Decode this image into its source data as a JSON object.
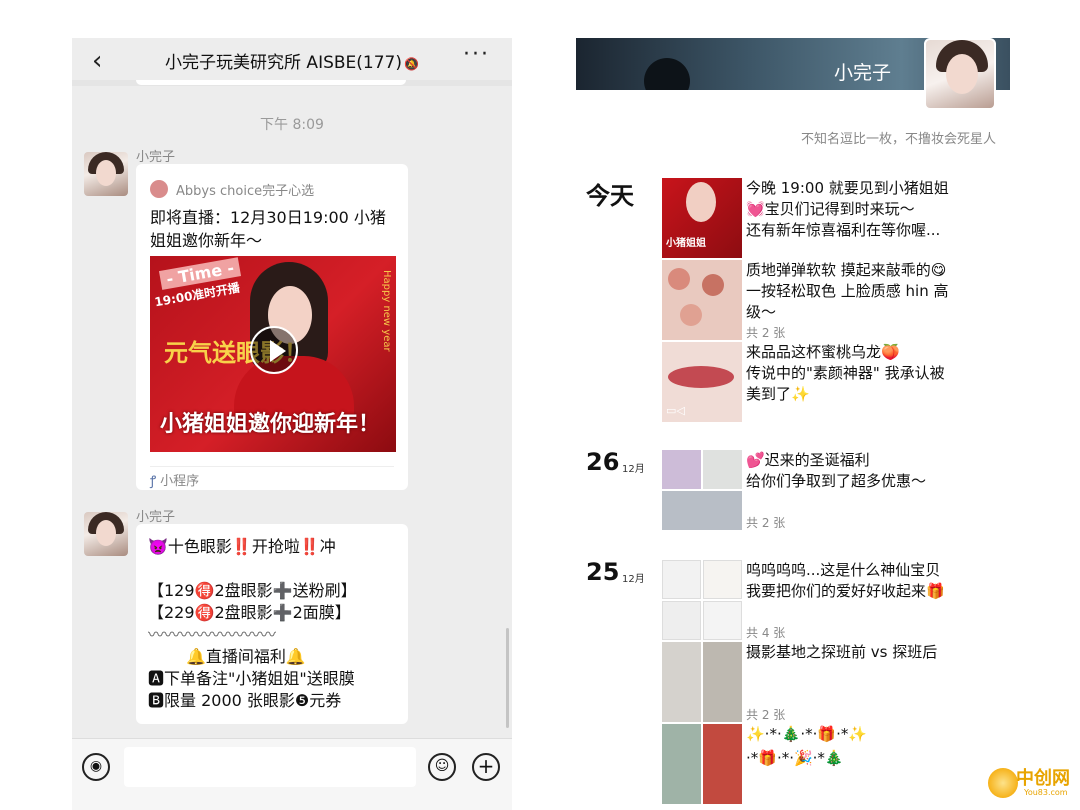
{
  "chat": {
    "title": "小完子玩美研究所 AISBE(177)",
    "time": "下午 8:09",
    "messages": [
      {
        "sender": "小完子",
        "type": "mini_program",
        "source": "Abbys choice完子心选",
        "desc_lines": [
          "即将直播：12月30日19:00 小猪",
          "姐姐邀你新年～"
        ],
        "cover_text": {
          "tag": "- Time -",
          "time": "19:00准时开播",
          "headline": "元气送眼影！",
          "banner": "小猪姐姐邀你迎新年！",
          "side": "Happy new year"
        },
        "kind_label": "小程序"
      },
      {
        "sender": "小完子",
        "type": "text",
        "lines": [
          "👿十色眼影‼️开抢啦‼️冲",
          "",
          "【129🉐2盘眼影➕送粉刷】",
          "【229🉐2盘眼影➕2面膜】",
          "〰〰〰〰〰〰〰〰",
          "🔔直播间福利🔔",
          "🅰下单备注\"小猪姐姐\"送眼膜",
          "🅱限量 2000 张眼影❺元券"
        ]
      }
    ]
  },
  "profile": {
    "name": "小完子",
    "signature": "不知名逗比一枚，不撸妆会死星人",
    "days": [
      {
        "day": "今天",
        "month": "",
        "posts": [
          {
            "lines": [
              "今晚 19:00 就要见到小猪姐姐",
              "💓宝贝们记得到时来玩～",
              "还有新年惊喜福利在等你喔..."
            ],
            "count": ""
          },
          {
            "lines": [
              "质地弹弹软软 摸起来敲乖的😋",
              "一按轻松取色 上脸质感 hin 高",
              "级～"
            ],
            "count": "共 2 张"
          },
          {
            "lines": [
              "来品品这杯蜜桃乌龙🍑",
              "传说中的\"素颜神器\" 我承认被",
              "美到了✨"
            ],
            "count": ""
          }
        ]
      },
      {
        "day": "26",
        "month": "12月",
        "posts": [
          {
            "lines": [
              "💕迟来的圣诞福利",
              "给你们争取到了超多优惠～"
            ],
            "count": "共 2 张"
          }
        ]
      },
      {
        "day": "25",
        "month": "12月",
        "posts": [
          {
            "lines": [
              "呜呜呜呜...这是什么神仙宝贝",
              "我要把你们的爱好好收起来🎁"
            ],
            "count": "共 4 张"
          },
          {
            "lines": [
              "摄影基地之探班前 vs 探班后"
            ],
            "count": "共 2 张"
          },
          {
            "lines": [
              "✨·*·🎄·*·🎁·*✨",
              "·*🎁·*·🎉·*🎄"
            ],
            "count": ""
          }
        ]
      }
    ]
  },
  "watermark": {
    "text": "中创网",
    "url": "You83.com"
  },
  "colors": {
    "chat_bg": "#ededed",
    "bubble": "#ffffff",
    "cover_red": "#d51f27",
    "accent_gold": "#e8a400"
  }
}
